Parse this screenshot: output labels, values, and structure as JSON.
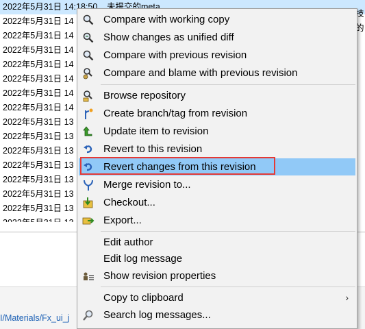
{
  "log": {
    "rows": [
      {
        "date": "2022年5月31日 14:18:50",
        "msg": "未提交的meta",
        "selected": true
      },
      {
        "date": "2022年5月31日 14",
        "msg": "",
        "selected": false
      },
      {
        "date": "2022年5月31日 14",
        "msg": "",
        "selected": false
      },
      {
        "date": "2022年5月31日 14",
        "msg": "",
        "selected": false
      },
      {
        "date": "2022年5月31日 14",
        "msg": "",
        "selected": false
      },
      {
        "date": "2022年5月31日 14",
        "msg": "",
        "selected": false
      },
      {
        "date": "2022年5月31日 14",
        "msg": "",
        "selected": false
      },
      {
        "date": "2022年5月31日 14",
        "msg": "",
        "selected": false
      },
      {
        "date": "2022年5月31日 13",
        "msg": "",
        "selected": false
      },
      {
        "date": "2022年5月31日 13",
        "msg": "",
        "selected": false
      },
      {
        "date": "2022年5月31日 13",
        "msg": "",
        "selected": false
      },
      {
        "date": "2022年5月31日 13",
        "msg": "",
        "selected": false
      },
      {
        "date": "2022年5月31日 13",
        "msg": "",
        "selected": false
      },
      {
        "date": "2022年5月31日 13",
        "msg": "",
        "selected": false
      },
      {
        "date": "2022年5月31日 13",
        "msg": "",
        "selected": false
      },
      {
        "date": "2022年5月31日 13",
        "msg": "",
        "selected": false
      }
    ],
    "right_fragments": [
      "技",
      "的"
    ]
  },
  "path_strip": {
    "text": "I/Materials/Fx_ui_j"
  },
  "menu": {
    "items": [
      {
        "label": "Compare with working copy",
        "icon": "magnifier-diff-icon"
      },
      {
        "label": "Show changes as unified diff",
        "icon": "magnifier-unified-diff-icon"
      },
      {
        "label": "Compare with previous revision",
        "icon": "magnifier-compare-previous-icon"
      },
      {
        "label": "Compare and blame with previous revision",
        "icon": "magnifier-blame-icon"
      },
      {
        "label": "Browse repository",
        "icon": "repository-browse-icon"
      },
      {
        "label": "Create branch/tag from revision",
        "icon": "branch-tag-icon"
      },
      {
        "label": "Update item to revision",
        "icon": "update-arrow-icon"
      },
      {
        "label": "Revert to this revision",
        "icon": "revert-icon"
      },
      {
        "label": "Revert changes from this revision",
        "icon": "revert-changes-icon"
      },
      {
        "label": "Merge revision to...",
        "icon": "merge-icon"
      },
      {
        "label": "Checkout...",
        "icon": "checkout-icon"
      },
      {
        "label": "Export...",
        "icon": "export-icon"
      },
      {
        "label": "Edit author",
        "icon": ""
      },
      {
        "label": "Edit log message",
        "icon": ""
      },
      {
        "label": "Show revision properties",
        "icon": "properties-icon"
      },
      {
        "label": "Copy to clipboard",
        "icon": "",
        "submenu": true
      },
      {
        "label": "Search log messages...",
        "icon": "search-icon"
      }
    ],
    "highlighted_index": 8,
    "submenu_arrow": "›",
    "colors": {
      "highlight": "#91c9f7",
      "annotation_box": "#e53935",
      "selected_row": "#cce8ff"
    }
  }
}
